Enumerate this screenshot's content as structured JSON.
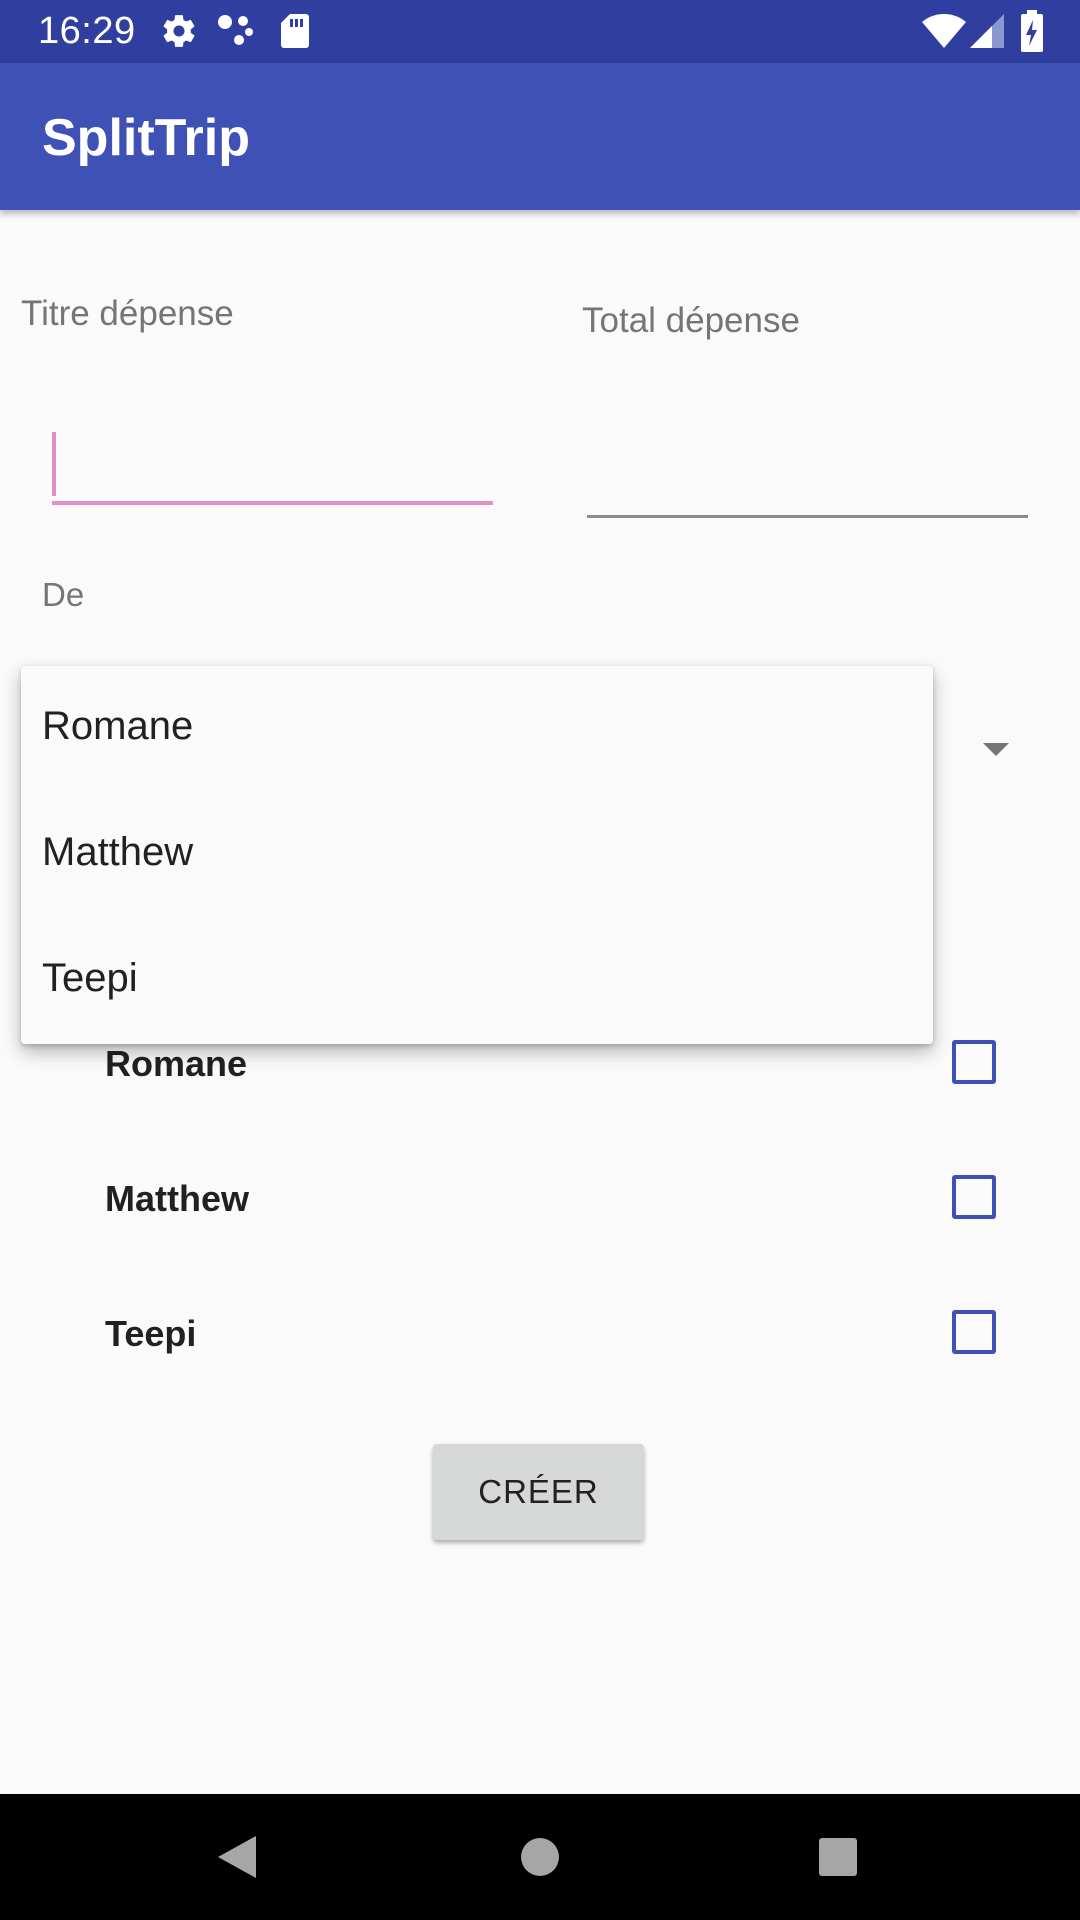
{
  "status_bar": {
    "time": "16:29",
    "icons_left": [
      "gear-icon",
      "assistant-dots-icon",
      "sd-card-icon"
    ],
    "icons_right": [
      "wifi-icon",
      "signal-icon",
      "battery-charging-icon"
    ]
  },
  "app_bar": {
    "title": "SplitTrip"
  },
  "form": {
    "title_label": "Titre dépense",
    "title_value": "",
    "total_label": "Total dépense",
    "total_value": "",
    "from_label": "De"
  },
  "dropdown": {
    "options": [
      "Romane",
      "Matthew",
      "Teepi"
    ]
  },
  "participants": [
    {
      "name": "Romane",
      "checked": false
    },
    {
      "name": "Matthew",
      "checked": false
    },
    {
      "name": "Teepi",
      "checked": false
    }
  ],
  "actions": {
    "create_label": "CRÉER"
  },
  "colors": {
    "status_bar": "#303f9f",
    "app_bar": "#3f51b5",
    "accent": "#e08fc9",
    "checkbox": "#3f51b5"
  }
}
